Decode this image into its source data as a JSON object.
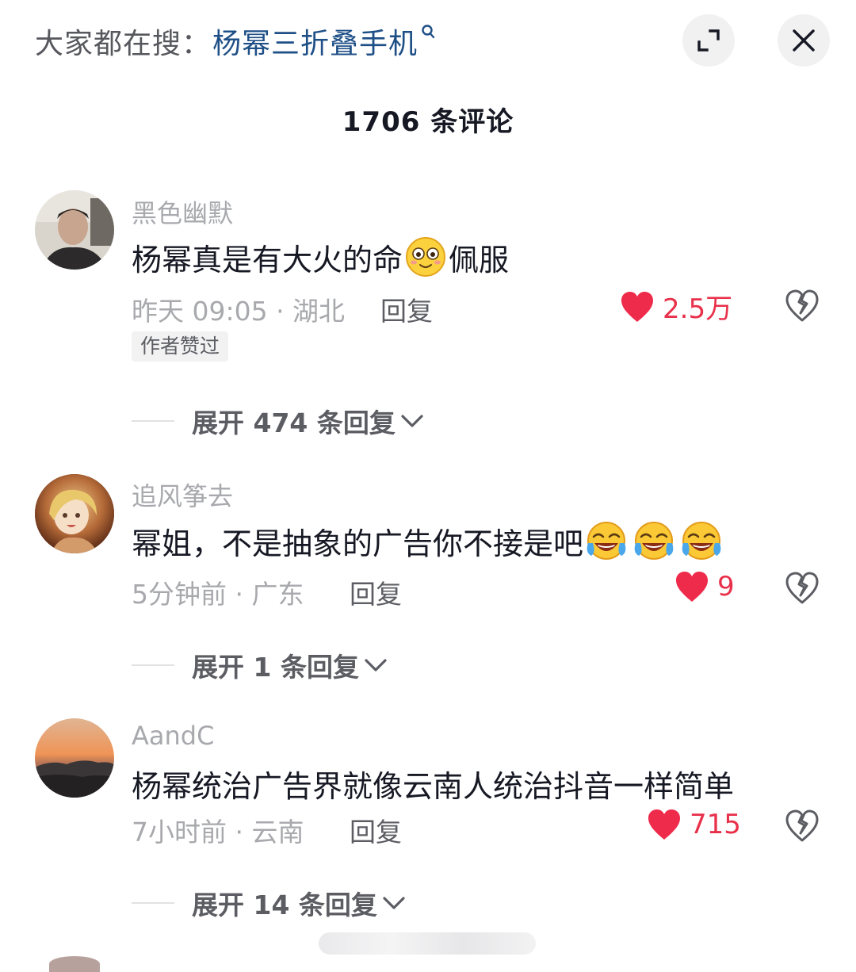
{
  "header": {
    "search_prefix": "大家都在搜：",
    "search_term": "杨幂三折叠手机",
    "search_icon": "search-icon",
    "expand_icon": "expand-icon",
    "close_icon": "close-icon"
  },
  "comment_count": "1706 条评论",
  "comments": [
    {
      "username": "黑色幽默",
      "text_before": "杨幂真是有大火的命",
      "emoji": "smiling-face-emoji",
      "text_after": "佩服",
      "time_location": "昨天 09:05 · 湖北",
      "reply_label": "回复",
      "likes": "2.5万",
      "badge": "作者赞过",
      "expand_label": "展开 474 条回复"
    },
    {
      "username": "追风筝去",
      "text": "幂姐，不是抽象的广告你不接是吧",
      "emojis": [
        "laughing-crying-emoji",
        "laughing-crying-emoji",
        "laughing-crying-emoji"
      ],
      "time_location": "5分钟前 · 广东",
      "reply_label": "回复",
      "likes": "9",
      "expand_label": "展开 1 条回复"
    },
    {
      "username": "AandC",
      "text": "杨幂统治广告界就像云南人统治抖音一样简单",
      "time_location": "7小时前 · 云南",
      "reply_label": "回复",
      "likes": "715",
      "expand_label": "展开 14 条回复"
    }
  ],
  "colors": {
    "accent_like": "#e8304a",
    "search_term": "#1e4f86",
    "muted_text": "#a8a9ad"
  }
}
